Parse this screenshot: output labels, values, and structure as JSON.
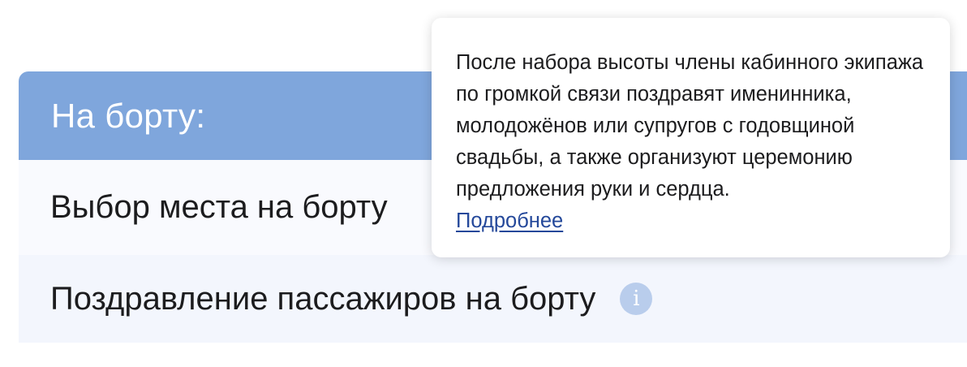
{
  "panel": {
    "title": "На борту:",
    "header_color": "#7fa6dc"
  },
  "services": [
    {
      "label": "Выбор места на борту"
    },
    {
      "label": "Поздравление пассажиров на борту",
      "info_icon": "info-icon"
    }
  ],
  "info_icon_glyph": "i",
  "tooltip": {
    "text": "После набора высоты члены кабинного экипажа по громкой связи поздравят именинника, молодожёнов или супругов с годовщиной свадьбы, а также организуют церемонию предложения руки и сердца.",
    "link_label": "Подробнее",
    "link_color": "#24489a"
  }
}
